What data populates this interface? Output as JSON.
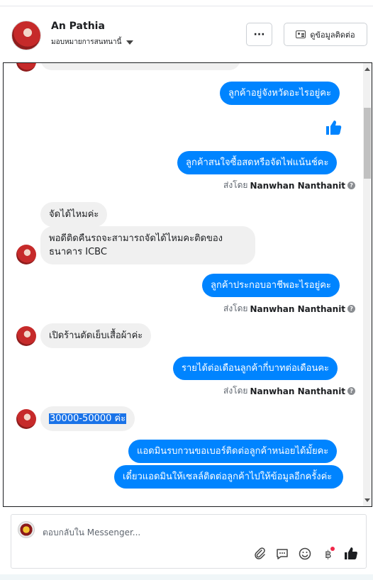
{
  "header": {
    "name": "An Pathia",
    "assign_label": "มอบหมายการสนทนานี้",
    "more_label": "···",
    "contact_label": "ดูข้อมูลติดต่อ"
  },
  "messages": {
    "cut_top": "ลูกค้าอยู่จังหวัดอะไรอยู่คะ",
    "out1": "ลูกค้าอยู่จังหวัดอะไรอยู่คะ",
    "out2": "ลูกค้าสนใจซื้อสดหรือจัดไฟแน้นช์คะ",
    "sent_prefix": "ส่งโดย",
    "sender": "Nanwhan Nanthanit",
    "in1": "จัดได้ไหมค่ะ",
    "in2": "พอดีติดคืนรถจะสามารถจัดได้ไหมคะติดของธนาคาร ICBC",
    "out3": "ลูกค้าประกอบอาชีพอะไรอยู่คะ",
    "in3": "เปิดร้านตัดเย็บเสื้อผ้าค่ะ",
    "out4": "รายได้ต่อเดือนลูกค้ากี่บาทต่อเดือนคะ",
    "in4": "30000-50000 ค่ะ",
    "out5": "แอดมินรบกวนขอเบอร์ติดต่อลูกค้าหน่อยได้มั้ยคะ",
    "out6": "เดี๋ยวแอดมินให้เซลล์ติดต่อลูกค้าไปให้ข้อมูลอีกครั้งค่ะ"
  },
  "composer": {
    "placeholder": "ตอบกลับใน Messenger..."
  },
  "colors": {
    "outgoing": "#0084ff",
    "incoming": "#f0f0f0"
  }
}
